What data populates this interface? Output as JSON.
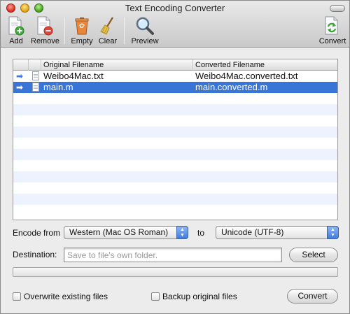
{
  "window": {
    "title": "Text Encoding Converter"
  },
  "toolbar": {
    "add_label": "Add",
    "remove_label": "Remove",
    "empty_label": "Empty",
    "clear_label": "Clear",
    "preview_label": "Preview",
    "convert_label": "Convert"
  },
  "table": {
    "headers": {
      "original": "Original Filename",
      "converted": "Converted Filename"
    },
    "rows": [
      {
        "status_icon": "arrow-right-icon",
        "original": "Weibo4Mac.txt",
        "converted": "Weibo4Mac.converted.txt",
        "selected": false
      },
      {
        "status_icon": "arrow-right-icon",
        "original": "main.m",
        "converted": "main.converted.m",
        "selected": true
      }
    ]
  },
  "encoding": {
    "from_label": "Encode from",
    "from_value": "Western (Mac OS Roman)",
    "to_label": "to",
    "to_value": "Unicode (UTF-8)"
  },
  "destination": {
    "label": "Destination:",
    "placeholder": "Save to file's own folder.",
    "value": "",
    "select_label": "Select"
  },
  "progress": {
    "value": 0
  },
  "options": {
    "overwrite_label": "Overwrite existing files",
    "overwrite_checked": false,
    "backup_label": "Backup original files",
    "backup_checked": false,
    "convert_label": "Convert"
  },
  "colors": {
    "selection": "#3875d7",
    "alt_row": "#edf3fe",
    "status_arrow": "#3c78d8"
  }
}
